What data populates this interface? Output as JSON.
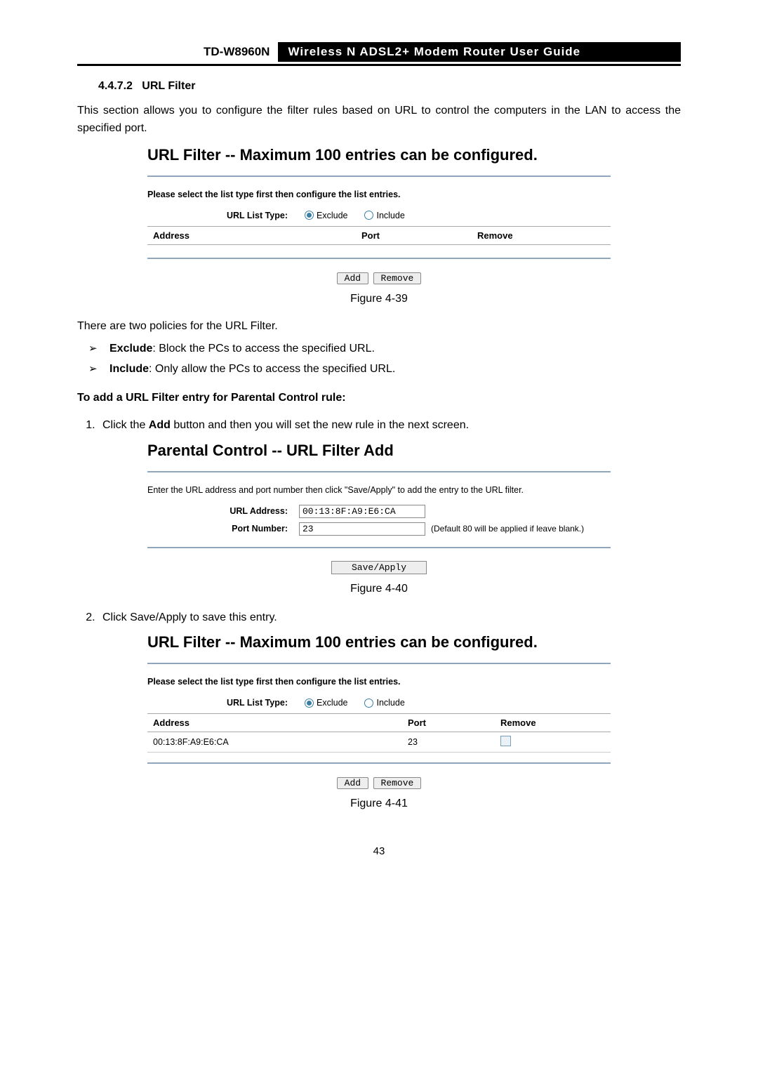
{
  "header": {
    "model": "TD-W8960N",
    "title": "Wireless N ADSL2+ Modem Router User Guide"
  },
  "section": {
    "num": "4.4.7.2",
    "name": "URL Filter"
  },
  "intro": "This section allows you to configure the filter rules based on URL to control the computers in the LAN to access the specified port.",
  "fig39": {
    "title": "URL Filter -- Maximum 100 entries can be configured.",
    "instruction": "Please select the list type first then configure the list entries.",
    "listTypeLabel": "URL List Type:",
    "opt_exclude": "Exclude",
    "opt_include": "Include",
    "th_address": "Address",
    "th_port": "Port",
    "th_remove": "Remove",
    "btn_add": "Add",
    "btn_remove": "Remove",
    "caption": "Figure 4-39"
  },
  "policies_intro": "There are two policies for the URL Filter.",
  "policy1_label": "Exclude",
  "policy1_text": ": Block the PCs to access the specified URL.",
  "policy2_label": "Include",
  "policy2_text": ": Only allow the PCs to access the specified URL.",
  "addrule_heading": "To add a URL Filter entry for Parental Control rule:",
  "step1_pre": "Click the ",
  "step1_bold": "Add",
  "step1_post": " button and then you will set the new rule in the next screen.",
  "fig40": {
    "title": "Parental Control -- URL Filter Add",
    "instruction": "Enter the URL address and port number then click \"Save/Apply\" to add the entry to the URL filter.",
    "label_url": "URL Address:",
    "value_url": "00:13:8F:A9:E6:CA",
    "label_port": "Port Number:",
    "value_port": "23",
    "note": "(Default 80 will be applied if leave blank.)",
    "btn_save": "Save/Apply",
    "caption": "Figure 4-40"
  },
  "step2": "Click Save/Apply to save this entry.",
  "fig41": {
    "title": "URL Filter -- Maximum 100 entries can be configured.",
    "instruction": "Please select the list type first then configure the list entries.",
    "listTypeLabel": "URL List Type:",
    "opt_exclude": "Exclude",
    "opt_include": "Include",
    "th_address": "Address",
    "th_port": "Port",
    "th_remove": "Remove",
    "row_address": "00:13:8F:A9:E6:CA",
    "row_port": "23",
    "btn_add": "Add",
    "btn_remove": "Remove",
    "caption": "Figure 4-41"
  },
  "pagenum": "43"
}
